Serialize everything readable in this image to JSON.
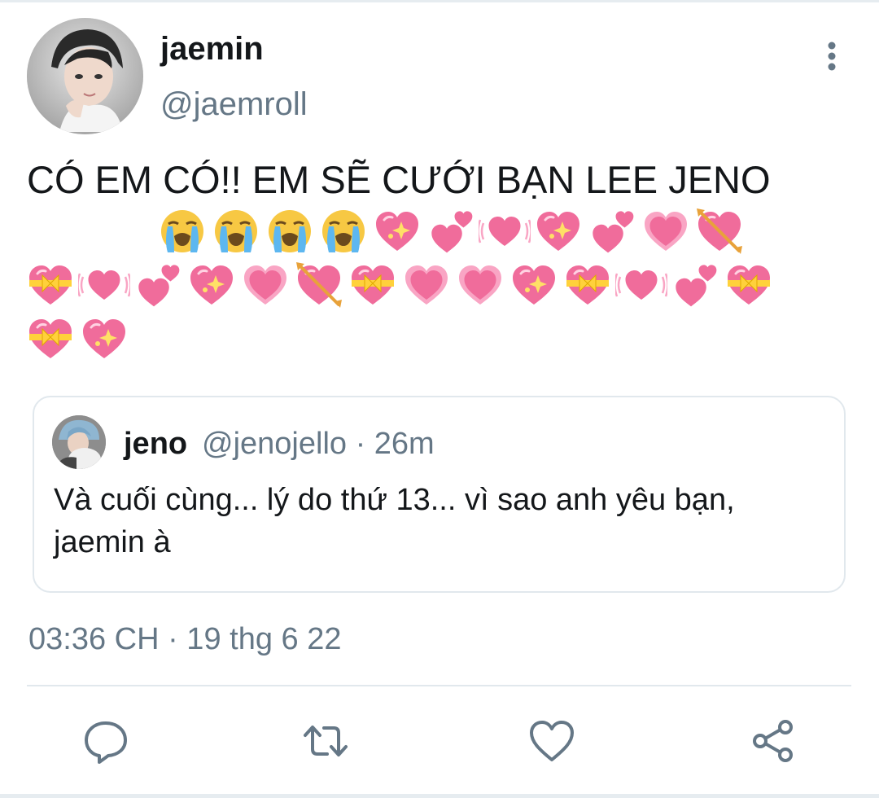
{
  "author": {
    "name": "jaemin",
    "handle": "@jaemroll"
  },
  "tweet": {
    "text": "CÓ EM CÓ!! EM SẼ CƯỚI BẠN LEE JENO",
    "emojis": [
      [
        "loudly-crying-face",
        "loudly-crying-face",
        "loudly-crying-face",
        "loudly-crying-face",
        "sparkling-heart",
        "two-hearts",
        "beating-heart",
        "sparkling-heart",
        "two-hearts",
        "growing-heart",
        "heart-with-arrow"
      ],
      [
        "heart-with-ribbon",
        "beating-heart",
        "two-hearts",
        "sparkling-heart",
        "growing-heart",
        "heart-with-arrow",
        "heart-with-ribbon",
        "growing-heart",
        "growing-heart",
        "sparkling-heart",
        "heart-with-ribbon",
        "beating-heart",
        "two-hearts",
        "heart-with-ribbon"
      ],
      [
        "heart-with-ribbon",
        "sparkling-heart"
      ]
    ]
  },
  "quoted": {
    "name": "jeno",
    "meta": "@jenojello · 26m",
    "text": "Và cuối cùng... lý do thứ 13... vì sao anh yêu bạn, jaemin à"
  },
  "timestamp": "03:36 CH · 19 thg 6 22",
  "actions": {
    "reply": "reply-icon",
    "retweet": "retweet-icon",
    "like": "heart-icon",
    "share": "share-icon"
  },
  "colors": {
    "text": "#14171a",
    "secondary": "#657786",
    "border": "#e1e8ed",
    "heart_pink": "#f06c9b"
  }
}
